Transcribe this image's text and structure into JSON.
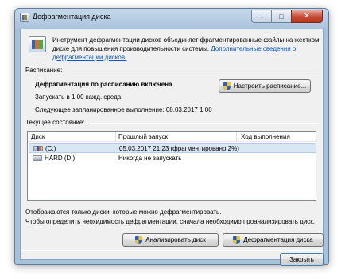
{
  "window": {
    "title": "Дефрагментация диска",
    "buttons": {
      "minimize": "–",
      "maximize": "□",
      "close": "✕"
    }
  },
  "intro": {
    "text": "Инструмент дефрагментации дисков объединяет фрагментированные файлы на жестком диске для повышения производительности системы. ",
    "link": "Дополнительные сведения о дефрагментации дисков."
  },
  "schedule": {
    "group_label": "Расписание:",
    "status": "Дефрагментация по расписанию включена",
    "run_time": "Запускать в 1:00 кажд. среда",
    "next_run": "Следующее запланированное выполнение: 08.03.2017 1:00",
    "configure_button": "Настроить расписание..."
  },
  "current_state": {
    "group_label": "Текущее состояние:",
    "columns": [
      "Диск",
      "Прошлый запуск",
      "Ход выполнения"
    ],
    "rows": [
      {
        "disk": "(C:)",
        "last_run": "05.03.2017 21:23 (фрагментировано 2%)",
        "progress": "",
        "icon": "system-drive-icon"
      },
      {
        "disk": "HARD (D:)",
        "last_run": "Никогда не запускать",
        "progress": "",
        "icon": "hard-drive-icon"
      }
    ]
  },
  "notes": {
    "line1": "Отображаются только диски, которые можно дефрагментировать.",
    "line2": "Чтобы определить неохидимость  дефрагментации, сначала необходимо проанализировать диск."
  },
  "actions": {
    "analyze_button": "Анализировать диск",
    "defrag_button": "Дефрагментация диска",
    "close_button": "Закрыть"
  }
}
